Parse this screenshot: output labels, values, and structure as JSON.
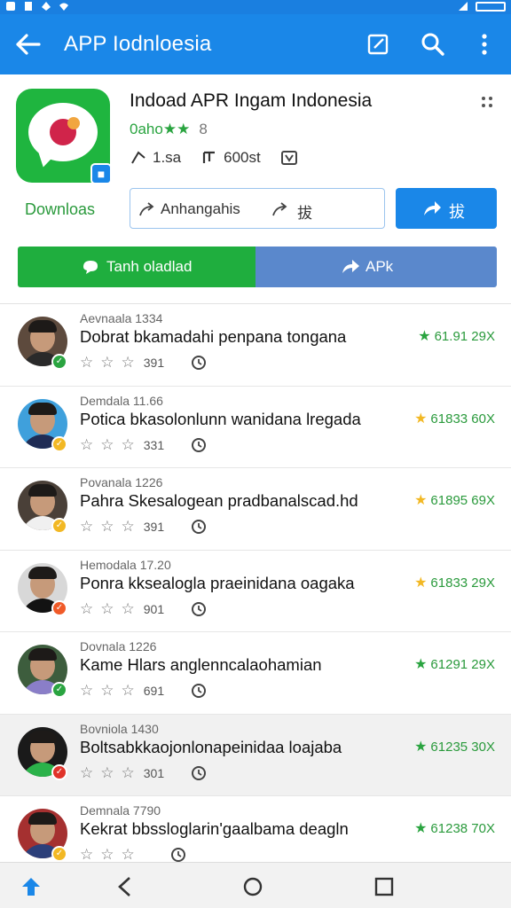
{
  "appbar": {
    "title": "APP Iodnloesia"
  },
  "app": {
    "name": "Indoad APR Ingam Indonesia",
    "rating_value": "0aho",
    "rating_stars": "★★",
    "rating_extra": "8",
    "meta_1": "1.sa",
    "meta_2": "600st",
    "downloads_label": "Downloas",
    "share_label_1": "Anhangahis",
    "share_label_2": "拔",
    "primary_button": "拔",
    "download_button": "Tanh oladlad",
    "apk_button": "APk"
  },
  "reviews": [
    {
      "name": "Aevnaala 1334",
      "title": "Dobrat bkamadahi penpana tongana",
      "count": "391",
      "score": "61.91 29X",
      "star_color": "#2aa440",
      "badge_color": "#2aa440",
      "shirt": "#2a2a2a",
      "bg": "#5d4a3d"
    },
    {
      "name": "Demdala 11.66",
      "title": "Potica bkasolonlunn wanidana lregada",
      "count": "331",
      "score": "61833 60X",
      "star_color": "#f2b824",
      "badge_color": "#f2b824",
      "shirt": "#1f2c55",
      "bg": "#3fa0dc"
    },
    {
      "name": "Povanala 1226",
      "title": "Pahra Skesalogean pradbanalscad.hd",
      "count": "391",
      "score": "61895 69X",
      "star_color": "#f2b824",
      "badge_color": "#f2b824",
      "shirt": "#f0f0f0",
      "bg": "#4a4038"
    },
    {
      "name": "Hemodala 17.20",
      "title": "Ponra kksealogla praeinidana oagaka",
      "count": "901",
      "score": "61833 29X",
      "star_color": "#f2b824",
      "badge_color": "#f05a28",
      "shirt": "#121212",
      "bg": "#d8d8d8"
    },
    {
      "name": "Dovnala 1226",
      "title": "Kame Hlars anglenncalaohamian",
      "count": "691",
      "score": "61291 29X",
      "star_color": "#2aa440",
      "badge_color": "#2aa440",
      "shirt": "#8a7ec8",
      "bg": "#3d5d3d"
    },
    {
      "name": "Bovniola 1430",
      "title": "Boltsabkkaojonlonapeinidaa loajaba",
      "count": "301",
      "score": "61235 30X",
      "star_color": "#2aa440",
      "badge_color": "#e0332a",
      "shirt": "#2bb24a",
      "bg": "#1a1a1a"
    },
    {
      "name": "Demnala 7790",
      "title": "Kekrat bbssloglarin'gaalbama deagln",
      "count": "",
      "score": "61238 70X",
      "star_color": "#2aa440",
      "badge_color": "#f2b824",
      "shirt": "#2c3f7a",
      "bg": "#a53030"
    }
  ]
}
